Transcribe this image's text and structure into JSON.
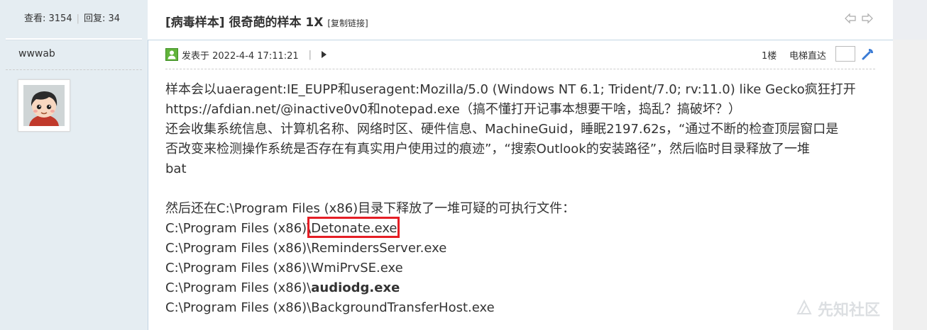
{
  "sidebar": {
    "views_label": "查看: 3154",
    "replies_label": "回复: 34",
    "author_name": "wwwab"
  },
  "header": {
    "title": "[病毒样本] 很奇葩的样本 1X",
    "copy_link": "[复制链接]"
  },
  "post_meta": {
    "posted_at": "发表于 2022-4-4 17:11:21",
    "floor": "1楼",
    "jump_label": "电梯直达"
  },
  "content": {
    "lines": [
      "样本会以uaeragent:IE_EUPP和useragent:Mozilla/5.0 (Windows NT 6.1; Trident/7.0; rv:11.0) like Gecko疯狂打开",
      "https://afdian.net/@inactive0v0和notepad.exe（搞不懂打开记事本想要干啥，捣乱？搞破坏？）",
      "还会收集系统信息、计算机名称、网络时区、硬件信息、MachineGuid，睡眠2197.62s，“通过不断的检查顶层窗口是",
      "否改变来检测操作系统是否存在有真实用户使用过的痕迹”，“搜索Outlook的安装路径”，然后临时目录释放了一堆",
      "bat",
      "",
      "然后还在C:\\Program Files (x86)目录下释放了一堆可疑的可执行文件："
    ],
    "file_prefix": "C:\\Program Files (x86)\\",
    "files": [
      "Detonate.exe",
      "RemindersServer.exe",
      "WmiPrvSE.exe",
      "audiodg.exe",
      "BackgroundTransferHost.exe"
    ]
  },
  "watermark": {
    "text": "先知社区"
  },
  "colors": {
    "highlight_box": "#e51e25",
    "sidebar_bg": "#e5edf2",
    "divider": "#c2d5e3"
  }
}
